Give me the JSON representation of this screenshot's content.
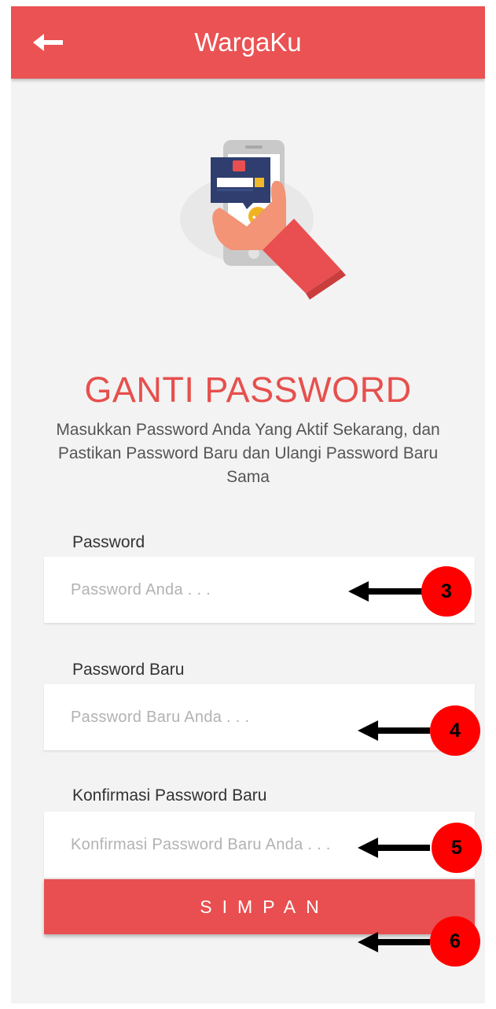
{
  "app_bar": {
    "title": "WargaKu"
  },
  "heading": "GANTI PASSWORD",
  "subtitle": "Masukkan Password Anda Yang Aktif Sekarang, dan Pastikan Password Baru dan Ulangi Password Baru Sama",
  "fields": [
    {
      "label": "Password",
      "placeholder": "Password Anda . . ."
    },
    {
      "label": "Password Baru",
      "placeholder": "Password Baru Anda . . ."
    },
    {
      "label": "Konfirmasi Password Baru",
      "placeholder": "Konfirmasi Password Baru Anda . . ."
    }
  ],
  "save_button": "SIMPAN",
  "annotations": [
    "3",
    "4",
    "5",
    "6"
  ],
  "colors": {
    "accent": "#ea5253",
    "heading": "#e6504d",
    "marker": "#ff0000"
  }
}
